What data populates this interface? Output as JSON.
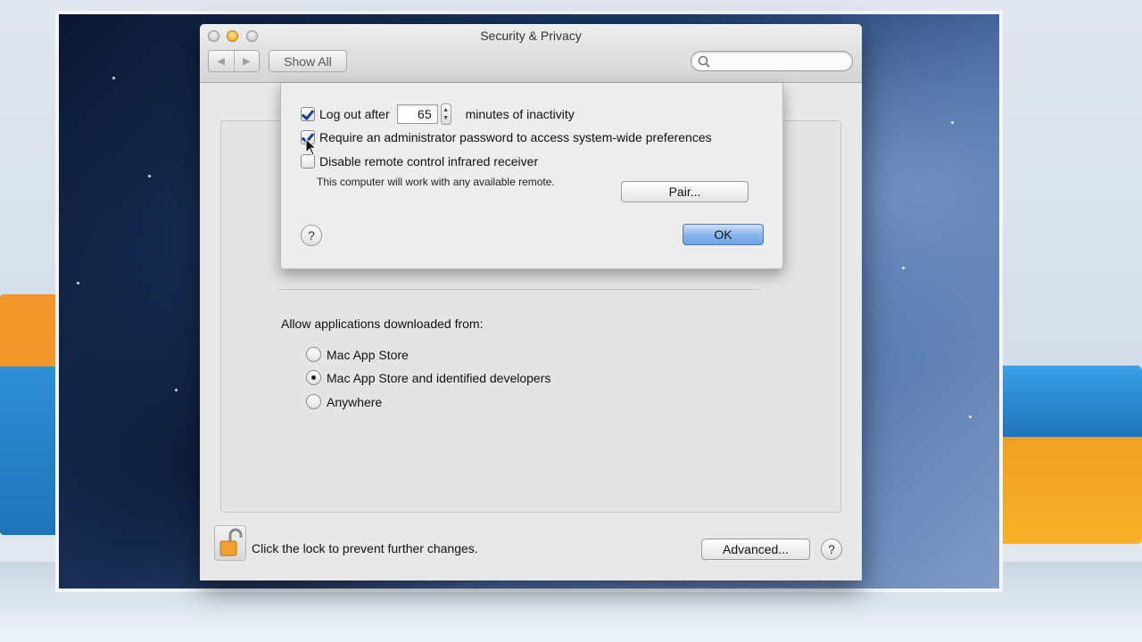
{
  "window": {
    "title": "Security & Privacy",
    "show_all": "Show All",
    "search_placeholder": ""
  },
  "sheet": {
    "logout_label": "Log out after",
    "logout_minutes": "65",
    "logout_suffix": "minutes of inactivity",
    "logout_checked": true,
    "require_admin_label": "Require an administrator password to access system-wide preferences",
    "require_admin_checked": true,
    "disable_ir_label": "Disable remote control infrared receiver",
    "disable_ir_checked": false,
    "ir_note": "This computer will work with any available remote.",
    "pair_button": "Pair...",
    "ok_button": "OK",
    "help": "?"
  },
  "main": {
    "allow_label": "Allow applications downloaded from:",
    "options": [
      {
        "label": "Mac App Store",
        "checked": false
      },
      {
        "label": "Mac App Store and identified developers",
        "checked": true
      },
      {
        "label": "Anywhere",
        "checked": false
      }
    ]
  },
  "footer": {
    "lock_text": "Click the lock to prevent further changes.",
    "advanced_button": "Advanced...",
    "help": "?"
  },
  "colors": {
    "accent": "#6fa3e6",
    "checkmark": "#1c3f8a"
  }
}
